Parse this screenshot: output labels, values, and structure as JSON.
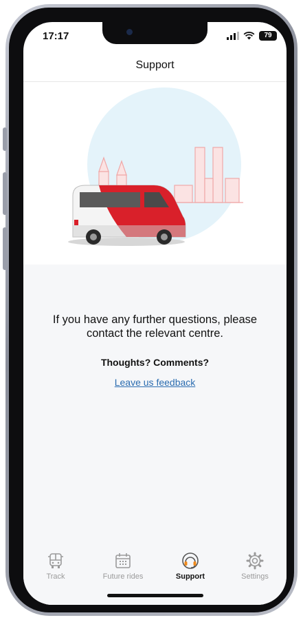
{
  "status_bar": {
    "time": "17:17",
    "battery": "79"
  },
  "header": {
    "title": "Support"
  },
  "main": {
    "info_text": "If you have any further questions, please contact the relevant centre.",
    "thoughts_label": "Thoughts? Comments?",
    "feedback_link": "Leave us feedback"
  },
  "tab_bar": {
    "items": [
      {
        "label": "Track",
        "icon": "bus-icon",
        "active": false
      },
      {
        "label": "Future rides",
        "icon": "calendar-icon",
        "active": false
      },
      {
        "label": "Support",
        "icon": "headset-icon",
        "active": true
      },
      {
        "label": "Settings",
        "icon": "gear-icon",
        "active": false
      }
    ]
  },
  "colors": {
    "accent": "#f08a1c",
    "brand_red": "#d9202a",
    "link": "#2b6cb0"
  }
}
